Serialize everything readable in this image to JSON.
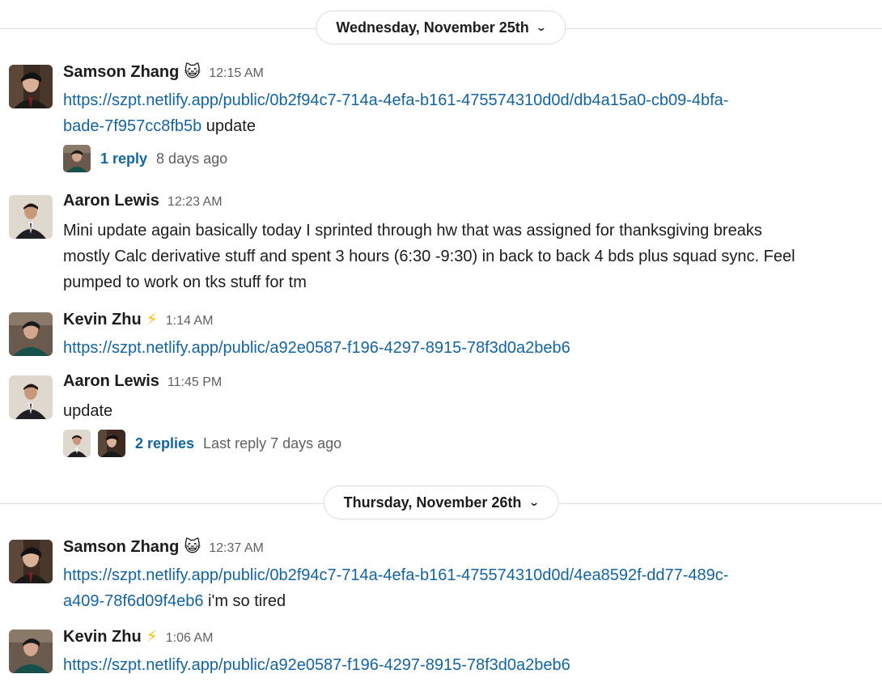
{
  "days": [
    {
      "label": "Wednesday, November 25th"
    },
    {
      "label": "Thursday, November 26th"
    }
  ],
  "messages": [
    {
      "name": "Samson Zhang",
      "status_emoji": "😺",
      "time": "12:15 AM",
      "link1": "https://szpt.netlify.app/public/0b2f94c7-714a-4efa-b161-475574310d0d/db4a15a0-cb09-4bfa-",
      "link2": "bade-7f957cc8fb5b",
      "text_after": " update",
      "thread": {
        "replies": "1 reply",
        "meta": "8 days ago"
      }
    },
    {
      "name": "Aaron Lewis",
      "time": "12:23 AM",
      "line1": "Mini update again basically today I sprinted through hw that was assigned for thanksgiving breaks",
      "line2": "mostly Calc derivative stuff and spent 3 hours (6:30 -9:30) in back to back 4 bds plus squad sync. Feel",
      "line3": "pumped to work on tks stuff for tm"
    },
    {
      "name": "Kevin Zhu",
      "status_emoji": "⚡",
      "time": "1:14 AM",
      "link1": "https://szpt.netlify.app/public/a92e0587-f196-4297-8915-78f3d0a2beb6"
    },
    {
      "name": "Aaron Lewis",
      "time": "11:45 PM",
      "text": "update",
      "thread": {
        "replies": "2 replies",
        "meta": "Last reply 7 days ago"
      }
    },
    {
      "name": "Samson Zhang",
      "status_emoji": "😺",
      "time": "12:37 AM",
      "link1": "https://szpt.netlify.app/public/0b2f94c7-714a-4efa-b161-475574310d0d/4ea8592f-dd77-489c-",
      "link2": "a409-78f6d09f4eb6",
      "text_after": " i'm so tired"
    },
    {
      "name": "Kevin Zhu",
      "status_emoji": "⚡",
      "time": "1:06 AM",
      "link1": "https://szpt.netlify.app/public/a92e0587-f196-4297-8915-78f3d0a2beb6"
    }
  ]
}
